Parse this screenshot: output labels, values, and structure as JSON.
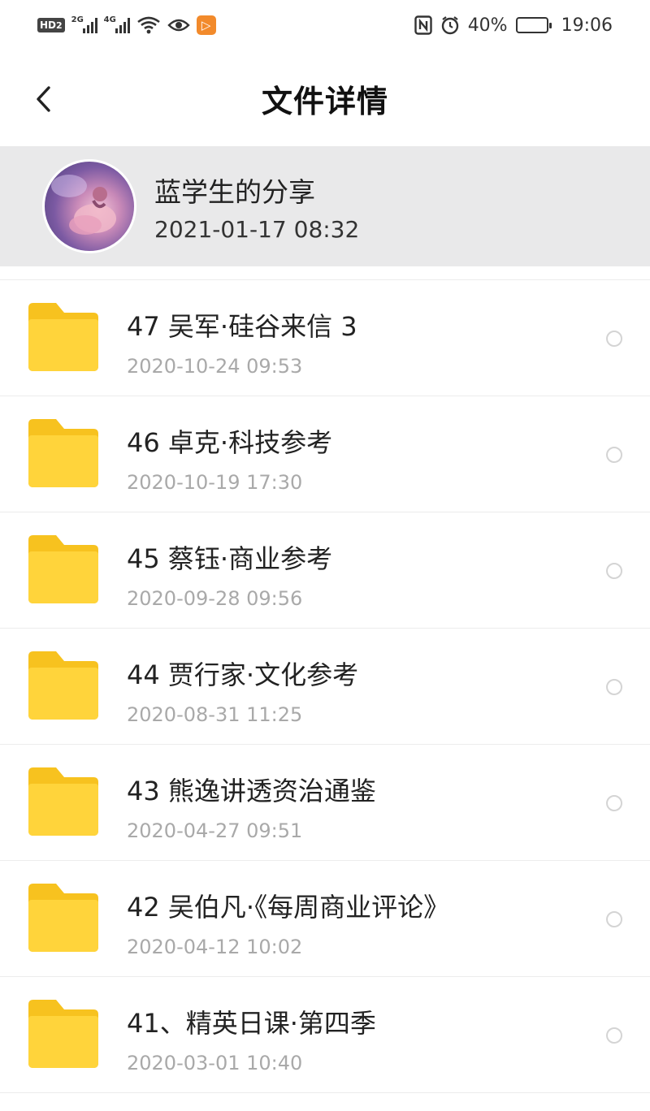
{
  "status_bar": {
    "hd": "HD",
    "hd_sub": "2",
    "sim1": "2G",
    "sim2": "4G",
    "battery_percent": "40%",
    "battery_level": 0.4,
    "time": "19:06",
    "icons": [
      "wifi-icon",
      "eye-icon",
      "app-badge-icon",
      "nfc-icon",
      "alarm-icon",
      "battery-icon"
    ]
  },
  "header": {
    "title": "文件详情"
  },
  "sharer": {
    "name": "蓝学生的分享",
    "time": "2021-01-17  08:32"
  },
  "colors": {
    "folder": "#ffd43b",
    "folder_tab": "#f7c21f",
    "card_bg": "#e9e9ea",
    "date_text": "#a9a9a9"
  },
  "files": [
    {
      "name": "47 吴军·硅谷来信 3",
      "date": "2020-10-24  09:53"
    },
    {
      "name": "46 卓克·科技参考",
      "date": "2020-10-19  17:30"
    },
    {
      "name": "45 蔡钰·商业参考",
      "date": "2020-09-28  09:56"
    },
    {
      "name": "44  贾行家·文化参考",
      "date": "2020-08-31  11:25"
    },
    {
      "name": "43 熊逸讲透资治通鉴",
      "date": "2020-04-27  09:51"
    },
    {
      "name": "42 吴伯凡·《每周商业评论》",
      "date": "2020-04-12  10:02"
    },
    {
      "name": "41、精英日课·第四季",
      "date": "2020-03-01  10:40"
    }
  ]
}
